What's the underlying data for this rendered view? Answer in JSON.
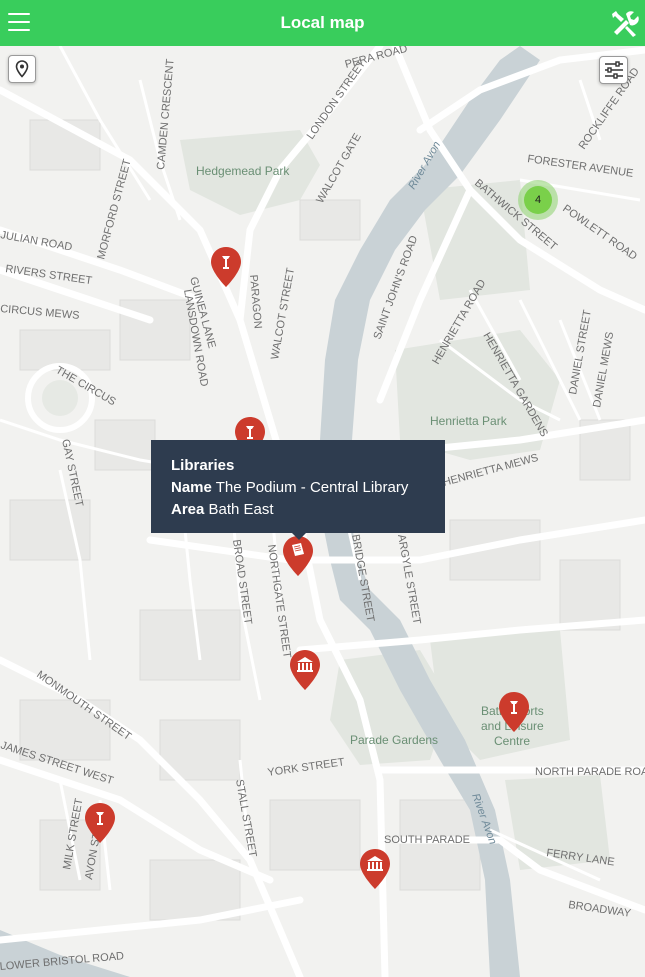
{
  "header": {
    "title": "Local map",
    "menu_icon": "hamburger-menu-icon",
    "tools_icon": "tools-icon"
  },
  "controls": {
    "locate_icon": "map-pin-icon",
    "filter_icon": "sliders-icon"
  },
  "cluster": {
    "count": "4",
    "color": "#6ecc39"
  },
  "tooltip": {
    "category": "Libraries",
    "name_label": "Name",
    "name_value": "The Podium - Central Library",
    "area_label": "Area",
    "area_value": "Bath East"
  },
  "markers": [
    {
      "type": "monument",
      "icon": "monument-icon"
    },
    {
      "type": "monument",
      "icon": "monument-icon"
    },
    {
      "type": "library",
      "icon": "book-icon"
    },
    {
      "type": "museum",
      "icon": "museum-icon"
    },
    {
      "type": "monument",
      "icon": "monument-icon"
    },
    {
      "type": "monument",
      "icon": "monument-icon"
    },
    {
      "type": "museum",
      "icon": "museum-icon"
    }
  ],
  "map_labels": {
    "hedgemead_park": "Hedgemead Park",
    "henrietta_park": "Henrietta Park",
    "parade_gardens": "Parade Gardens",
    "bath_sports": "Bath Sports",
    "leisure": "and Leisure",
    "centre": "Centre",
    "river_avon": "River Avon",
    "london_street": "LONDON STREET",
    "walcot_gate": "WALCOT GATE",
    "walcot_street": "WALCOT STREET",
    "paragon": "PARAGON",
    "lansdown_road": "LANSDOWN ROAD",
    "julian_road": "JULIAN ROAD",
    "rivers_street": "RIVERS STREET",
    "circus_mews": "CIRCUS MEWS",
    "the_circus": "THE CIRCUS",
    "gay_street": "GAY STREET",
    "forester_avenue": "FORESTER AVENUE",
    "bathwick_street": "BATHWICK STREET",
    "rockliffe_road": "ROCKLIFFE ROAD",
    "powlett_road": "POWLETT ROAD",
    "saint_johns_road": "SAINT JOHN'S ROAD",
    "henrietta_road": "HENRIETTA ROAD",
    "henrietta_gardens": "HENRIETTA GARDENS",
    "henrietta_mews": "HENRIETTA MEWS",
    "daniel_street": "DANIEL STREET",
    "daniel_mews": "DANIEL MEWS",
    "monmouth_street": "MONMOUTH STREET",
    "james_street_west": "JAMES STREET WEST",
    "york_street": "YORK STREET",
    "stall_street": "STALL STREET",
    "south_parade": "SOUTH PARADE",
    "north_parade_road": "NORTH PARADE ROAD",
    "ferry_lane": "FERRY LANE",
    "broadway": "BROADWAY",
    "milk_street": "MILK STREET",
    "lower_bristol_road": "LOWER BRISTOL ROAD",
    "camden_crescent": "CAMDEN CRESCENT",
    "morford_street": "MORFORD STREET",
    "pera_road": "PERA ROAD",
    "guinea_lane": "GUINEA LANE",
    "avon_street": "AVON STREET",
    "broad_street": "BROAD STREET",
    "northgate_street": "NORTHGATE STREET",
    "bridge_street": "BRIDGE STREET",
    "argyle_street": "ARGYLE STREET"
  }
}
